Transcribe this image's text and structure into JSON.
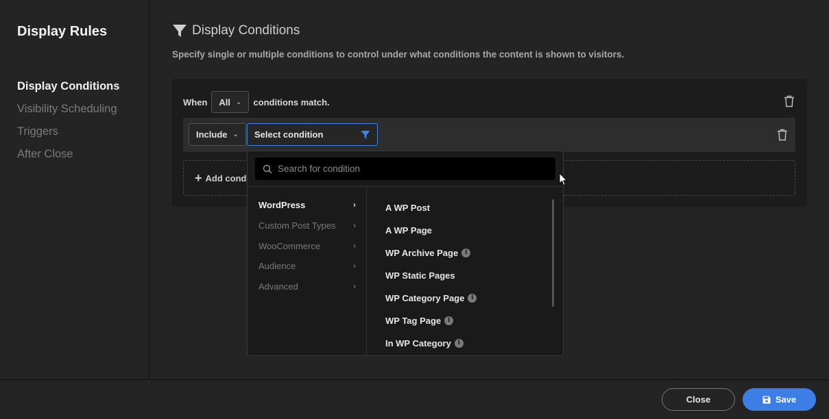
{
  "sidebar": {
    "title": "Display Rules",
    "items": [
      {
        "label": "Display Conditions",
        "active": true
      },
      {
        "label": "Visibility Scheduling",
        "active": false
      },
      {
        "label": "Triggers",
        "active": false
      },
      {
        "label": "After Close",
        "active": false
      }
    ]
  },
  "main": {
    "heading": "Display Conditions",
    "heading_icon": "filter-icon",
    "description": "Specify single or multiple conditions to control under what conditions the content is shown to visitors."
  },
  "panel": {
    "when_label": "When",
    "match_value": "All",
    "match_suffix": "conditions match.",
    "include_value": "Include",
    "condition_placeholder": "Select condition",
    "add_label": "Add condi"
  },
  "dropdown": {
    "search_placeholder": "Search for condition",
    "categories": [
      {
        "label": "WordPress",
        "active": true
      },
      {
        "label": "Custom Post Types",
        "active": false
      },
      {
        "label": "WooCommerce",
        "active": false
      },
      {
        "label": "Audience",
        "active": false
      },
      {
        "label": "Advanced",
        "active": false
      }
    ],
    "items": [
      {
        "label": "A WP Post",
        "info": false
      },
      {
        "label": "A WP Page",
        "info": false
      },
      {
        "label": "WP Archive Page",
        "info": true
      },
      {
        "label": "WP Static Pages",
        "info": false
      },
      {
        "label": "WP Category Page",
        "info": true
      },
      {
        "label": "WP Tag Page",
        "info": true
      },
      {
        "label": "In WP Category",
        "info": true
      }
    ]
  },
  "footer": {
    "close_label": "Close",
    "save_label": "Save"
  },
  "colors": {
    "accent": "#3d7ee6",
    "background": "#242424"
  }
}
